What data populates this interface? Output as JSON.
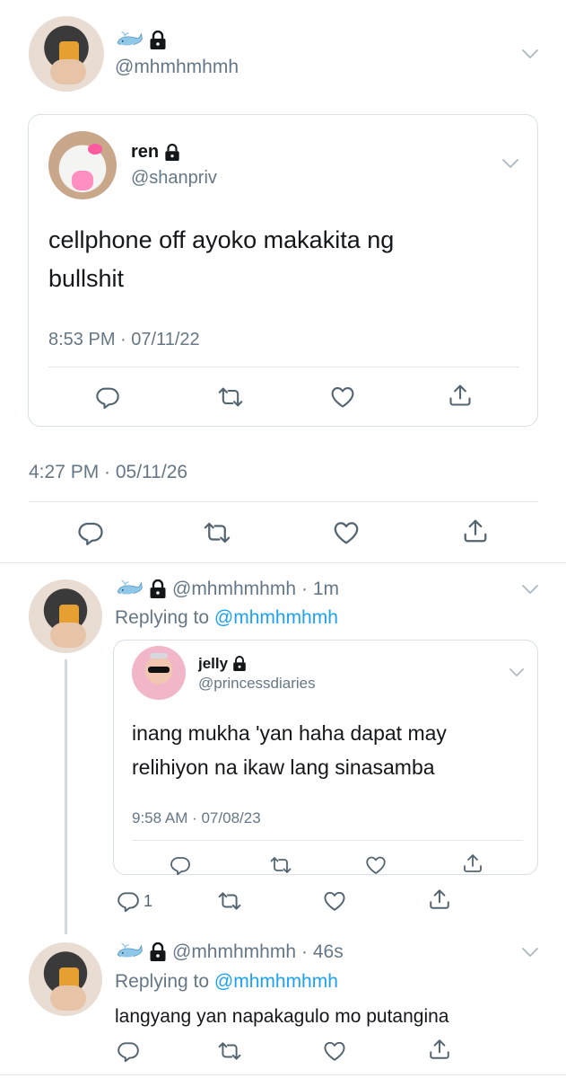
{
  "main_tweet": {
    "emoji": "🐳",
    "handle": "@mhmhmhmh",
    "timestamp": "4:27 PM · 05/11/26"
  },
  "quoted_tweet_1": {
    "name": "ren",
    "handle": "@shanpriv",
    "text_line1": "cellphone off ayoko makakita ng",
    "text_line2": "bullshit",
    "timestamp": "8:53 PM · 07/11/22"
  },
  "reply_1": {
    "emoji": "🐳",
    "handle": "@mhmhmhmh",
    "time": "· 1m",
    "replying_to_label": "Replying to",
    "replying_to_handle": "@mhmhmhmh",
    "reply_count": "1"
  },
  "quoted_tweet_2": {
    "name": "jelly",
    "handle": "@princessdiaries",
    "text_line1": "inang mukha 'yan haha dapat may",
    "text_line2": "relihiyon na ikaw lang sinasamba",
    "timestamp": "9:58 AM · 07/08/23"
  },
  "reply_2": {
    "emoji": "🐳",
    "handle": "@mhmhmhmh",
    "time": "· 46s",
    "replying_to_label": "Replying to",
    "replying_to_handle": "@mhmhmhmh",
    "text": "langyang yan napakagulo mo putangina"
  },
  "colors": {
    "link": "#1da1f2",
    "secondary_text": "#657786",
    "divider": "#e1e8ed",
    "icon": "#536471"
  },
  "icons": [
    "whale-emoji",
    "lock-icon",
    "chevron-down-icon",
    "reply-icon",
    "retweet-icon",
    "like-icon",
    "share-icon"
  ]
}
